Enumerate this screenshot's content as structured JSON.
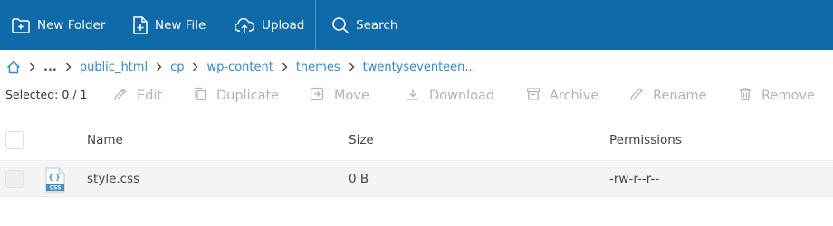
{
  "toolbar": {
    "new_folder": "New Folder",
    "new_file": "New File",
    "upload": "Upload",
    "search": "Search"
  },
  "breadcrumb": {
    "home_icon": "home-icon",
    "ellipsis": "...",
    "items": [
      "public_html",
      "cp",
      "wp-content",
      "themes",
      "twentyseventeen..."
    ]
  },
  "actions": {
    "selected": "Selected: 0 / 1",
    "edit": "Edit",
    "duplicate": "Duplicate",
    "move": "Move",
    "download": "Download",
    "archive": "Archive",
    "rename": "Rename",
    "remove": "Remove"
  },
  "table": {
    "columns": [
      "Name",
      "Size",
      "Permissions"
    ],
    "rows": [
      {
        "name": "style.css",
        "size": "0 B",
        "permissions": "-rw-r--r--",
        "type_icon_label": "CSS",
        "type_icon_glyph": "{ }"
      }
    ]
  },
  "colors": {
    "toolbar_bg": "#0e6aa8",
    "link": "#2f8bcf",
    "disabled": "#b3b3b3",
    "row_bg": "#f4f4f4"
  }
}
